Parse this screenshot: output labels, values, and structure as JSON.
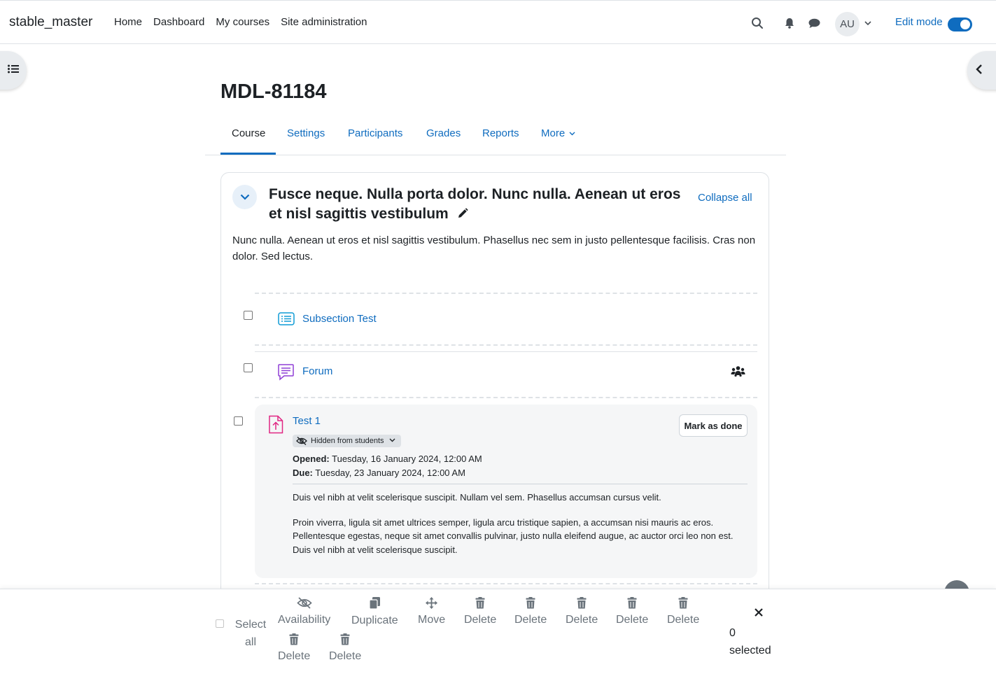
{
  "brand": "stable_master",
  "nav": {
    "items": [
      "Home",
      "Dashboard",
      "My courses",
      "Site administration"
    ],
    "user_initials": "AU",
    "edit_mode_label": "Edit mode"
  },
  "page_title": "MDL-81184",
  "tabs": {
    "course": "Course",
    "settings": "Settings",
    "participants": "Participants",
    "grades": "Grades",
    "reports": "Reports",
    "more": "More"
  },
  "section": {
    "title": "Fusce neque. Nulla porta dolor. Nunc nulla. Aenean ut eros et nisl sagittis vestibulum",
    "collapse_all": "Collapse all",
    "summary": "Nunc nulla. Aenean ut eros et nisl sagittis vestibulum. Phasellus nec sem in justo pellentesque facilisis. Cras non dolor. Sed lectus.",
    "activities": {
      "subsection": "Subsection Test",
      "forum": "Forum",
      "assignment": {
        "name": "Test 1",
        "mark_done": "Mark as done",
        "visibility": "Hidden from students",
        "opened_label": "Opened:",
        "opened_value": "Tuesday, 16 January 2024, 12:00 AM",
        "due_label": "Due:",
        "due_value": "Tuesday, 23 January 2024, 12:00 AM",
        "desc1": "Duis vel nibh at velit scelerisque suscipit. Nullam vel sem. Phasellus accumsan cursus velit.",
        "desc2": "Proin viverra, ligula sit amet ultrices semper, ligula arcu tristique sapien, a accumsan nisi mauris ac eros. Pellentesque egestas, neque sit amet convallis pulvinar, justo nulla eleifend augue, ac auctor orci leo non est. Duis vel nibh at velit scelerisque suscipit."
      }
    }
  },
  "bulk": {
    "select_all": "Select all",
    "availability": "Availability",
    "duplicate": "Duplicate",
    "move": "Move",
    "delete": "Delete",
    "selected_count": "0",
    "selected_label": "selected"
  },
  "colors": {
    "link": "#0f6cbf",
    "text": "#1d2125",
    "muted": "#6a737b",
    "forum_icon": "#8f3fd6",
    "assign_icon": "#e02683",
    "subsection_icon": "#0f9bd5"
  }
}
